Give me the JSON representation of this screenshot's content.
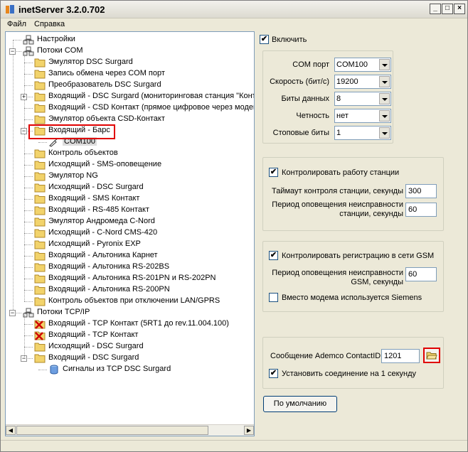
{
  "window": {
    "title": "inetServer 3.2.0.702",
    "min": "_",
    "max": "□",
    "close": "×"
  },
  "menu": [
    "Файл",
    "Справка"
  ],
  "tree": [
    {
      "label": "Настройки",
      "name": "tree-item-settings"
    },
    {
      "label": "Потоки COM",
      "name": "tree-item-com-streams"
    },
    {
      "label": "Эмулятор DSC Surgard",
      "name": "tree-item"
    },
    {
      "label": "Запись обмена через COM порт",
      "name": "tree-item"
    },
    {
      "label": "Преобразователь DSC Surgard",
      "name": "tree-item"
    },
    {
      "label": "Входящий - DSC Surgard (мониторинговая станция \"Конт",
      "name": "tree-item"
    },
    {
      "label": "Входящий - CSD Контакт (прямое цифровое через модем",
      "name": "tree-item"
    },
    {
      "label": "Эмулятор объекта CSD-Контакт",
      "name": "tree-item"
    },
    {
      "label": "Входящий - Барс",
      "name": "tree-item-bars"
    },
    {
      "label": "COM100",
      "name": "tree-item-com100"
    },
    {
      "label": "Контроль объектов",
      "name": "tree-item"
    },
    {
      "label": "Исходящий - SMS-оповещение",
      "name": "tree-item"
    },
    {
      "label": "Эмулятор NG",
      "name": "tree-item"
    },
    {
      "label": "Исходящий - DSC Surgard",
      "name": "tree-item"
    },
    {
      "label": "Входящий - SMS Контакт",
      "name": "tree-item"
    },
    {
      "label": "Входящий - RS-485 Контакт",
      "name": "tree-item"
    },
    {
      "label": "Эмулятор Андромеда C-Nord",
      "name": "tree-item"
    },
    {
      "label": "Исходящий - C-Nord CMS-420",
      "name": "tree-item"
    },
    {
      "label": "Исходящий - Pyronix EXP",
      "name": "tree-item"
    },
    {
      "label": "Входящий - Альтоника Карнет",
      "name": "tree-item"
    },
    {
      "label": "Входящий - Альтоника RS-202BS",
      "name": "tree-item"
    },
    {
      "label": "Входящий - Альтоника RS-201PN и RS-202PN",
      "name": "tree-item"
    },
    {
      "label": "Входящий - Альтоника RS-200PN",
      "name": "tree-item"
    },
    {
      "label": "Контроль объектов при отключении LAN/GPRS",
      "name": "tree-item"
    },
    {
      "label": "Потоки TCP/IP",
      "name": "tree-item-tcp-streams"
    },
    {
      "label": "Входящий - TCP Контакт (5RT1 до rev.11.004.100)",
      "name": "tree-item"
    },
    {
      "label": "Входящий - TCP Контакт",
      "name": "tree-item"
    },
    {
      "label": "Исходящий - DSC Surgard",
      "name": "tree-item"
    },
    {
      "label": "Входящий - DSC Surgard",
      "name": "tree-item"
    },
    {
      "label": "Сигналы из TCP DSC Surgard",
      "name": "tree-item"
    }
  ],
  "enabled": {
    "label": "Включить",
    "checked": "✔"
  },
  "com": {
    "port_label": "COM порт",
    "port_value": "COM100",
    "speed_label": "Скорость (бит/с)",
    "speed_value": "19200",
    "databits_label": "Биты данных",
    "databits_value": "8",
    "parity_label": "Четность",
    "parity_value": "нет",
    "stopbits_label": "Стоповые биты",
    "stopbits_value": "1"
  },
  "station": {
    "check_label": "Контролировать работу станции",
    "checked": "✔",
    "timeout_label": "Таймаут контроля станции, секунды",
    "timeout_value": "300",
    "period_label_1": "Период оповещения неисправности",
    "period_label_2": "станции, секунды",
    "period_value": "60"
  },
  "gsm": {
    "check_label": "Контролировать регистрацию в сети GSM",
    "checked": "✔",
    "period_label_1": "Период оповещения неисправности",
    "period_label_2": "GSM, секунды",
    "period_value": "60",
    "siemens_label": "Вместо модема используется Siemens",
    "siemens_checked": ""
  },
  "ademco": {
    "label": "Сообщение Ademco ContactID",
    "value": "1201",
    "connect_label": "Установить соединение на 1 секунду",
    "connect_checked": "✔"
  },
  "default_button": "По умолчанию",
  "colors": {
    "highlight": "#e00000",
    "folder": "#f2d36b",
    "accent_border": "#7f9db9"
  }
}
